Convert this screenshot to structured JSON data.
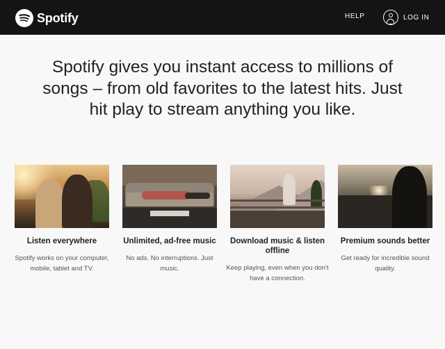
{
  "header": {
    "brand": "Spotify",
    "help_label": "HELP",
    "login_label": "LOG IN"
  },
  "headline": "Spotify gives you instant access to millions of songs – from old favorites to the latest hits. Just hit play to stream anything you like.",
  "features": [
    {
      "title": "Listen everywhere",
      "description": "Spotify works on your computer, mobile, tablet and TV."
    },
    {
      "title": "Unlimited, ad-free music",
      "description": "No ads. No interruptions. Just music."
    },
    {
      "title": "Download music & listen offline",
      "description": "Keep playing, even when you don't have a connection."
    },
    {
      "title": "Premium sounds better",
      "description": "Get ready for incredible sound quality."
    }
  ],
  "colors": {
    "header_bg": "#141414",
    "page_bg": "#f8f8f8",
    "text": "#222222"
  }
}
